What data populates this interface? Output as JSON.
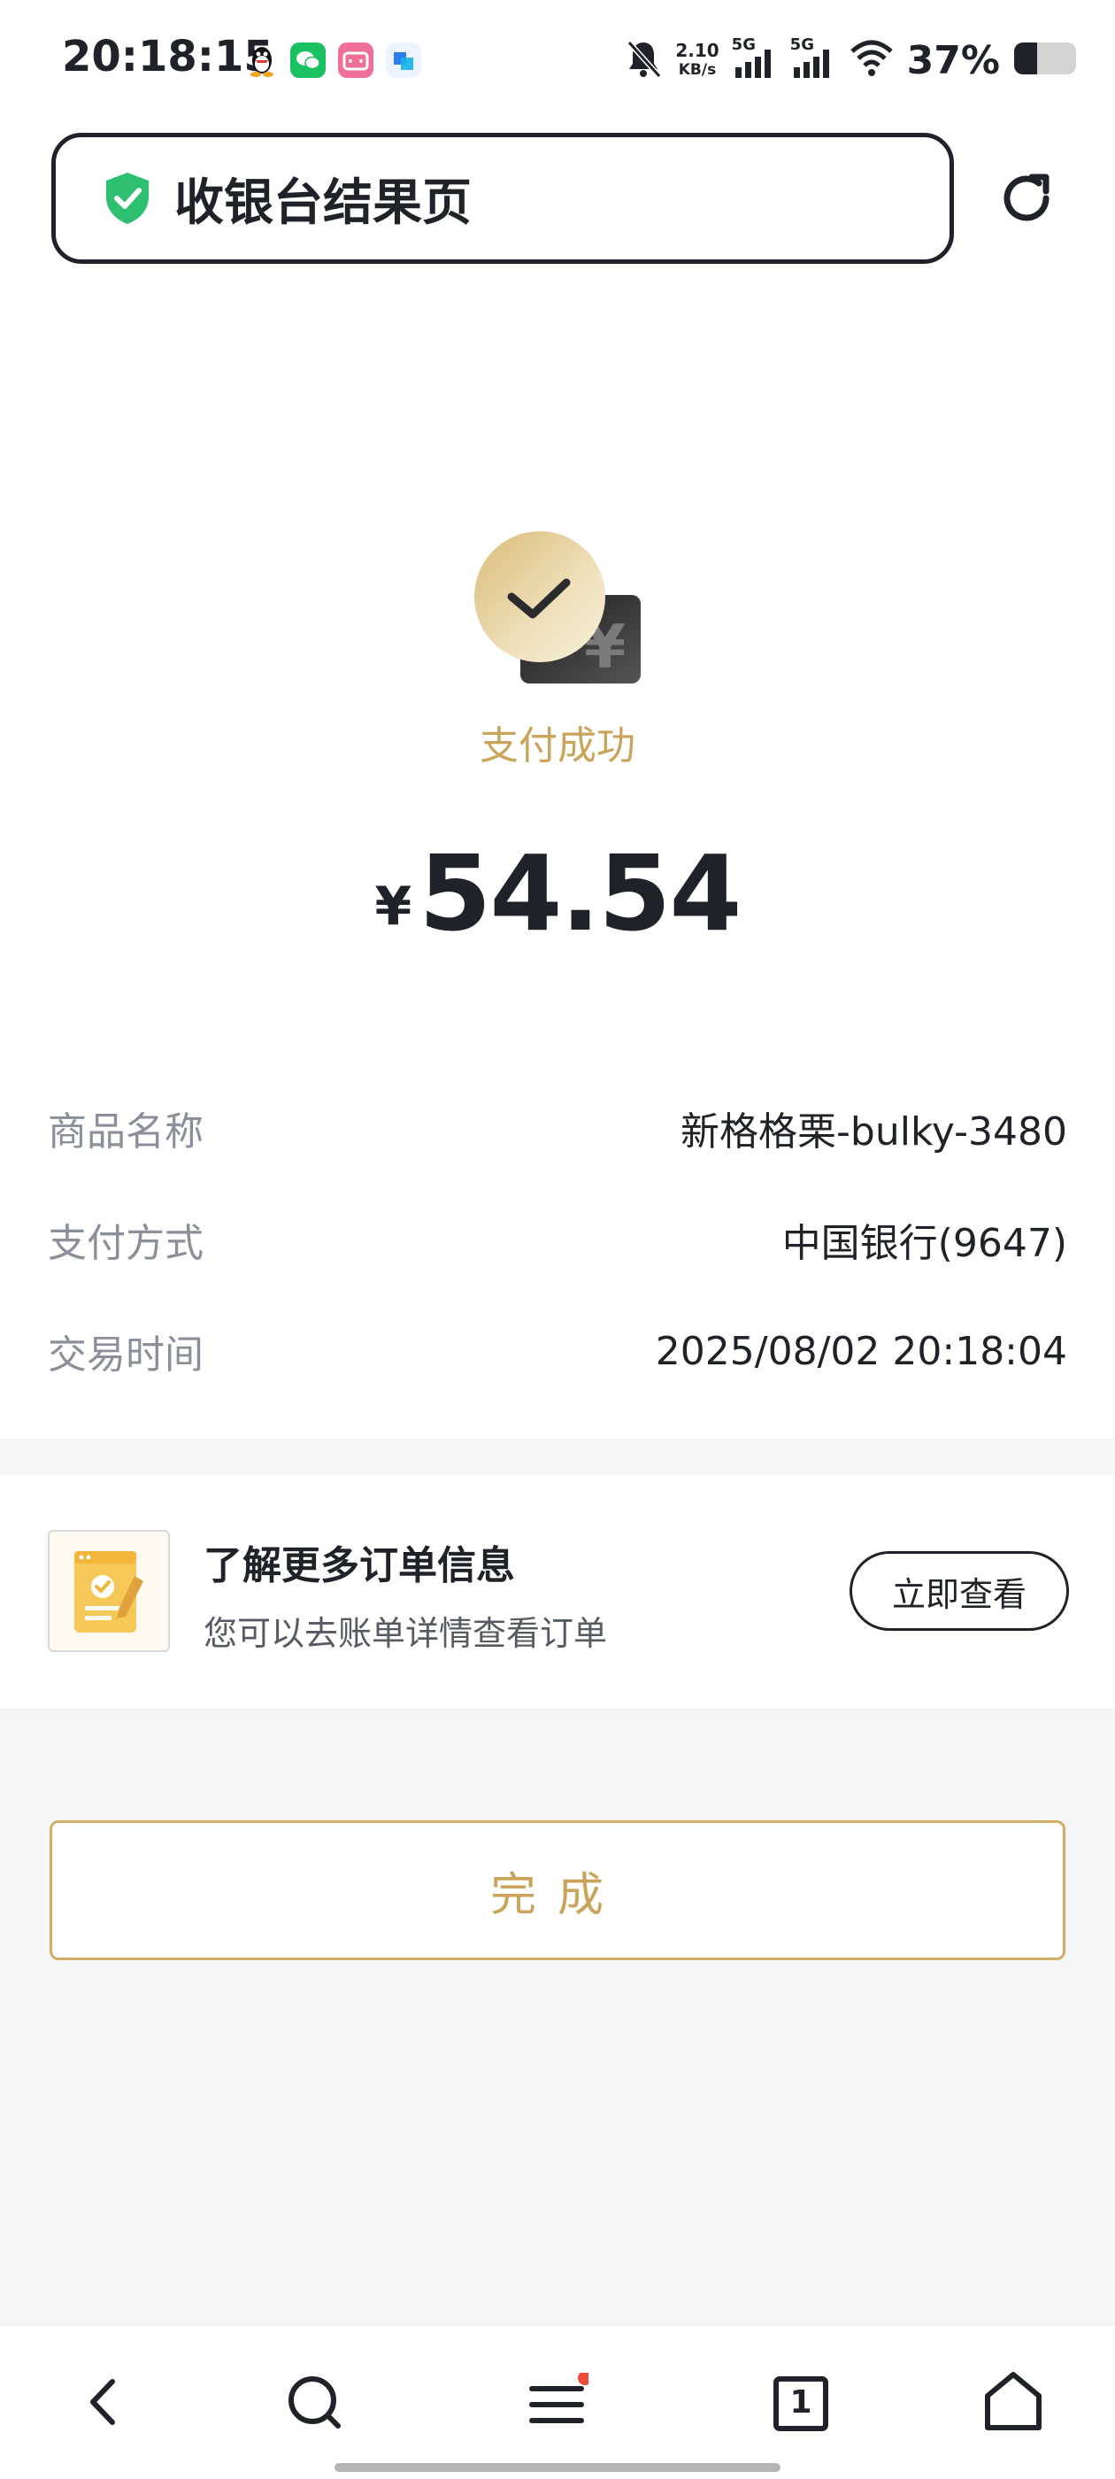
{
  "status_bar": {
    "time": "20:18:15",
    "net_speed_value": "2.10",
    "net_speed_unit": "KB/s",
    "signal_1": "5G",
    "signal_2": "5G",
    "battery": "37%"
  },
  "header": {
    "title": "收银台结果页"
  },
  "result": {
    "status": "支付成功",
    "currency": "¥",
    "amount": "54.54"
  },
  "details": [
    {
      "label": "商品名称",
      "value": "新格格栗-bulky-3480"
    },
    {
      "label": "支付方式",
      "value": "中国银行(9647)"
    },
    {
      "label": "交易时间",
      "value": "2025/08/02 20:18:04"
    }
  ],
  "order_card": {
    "title": "了解更多订单信息",
    "subtitle": "您可以去账单详情查看订单",
    "button": "立即查看"
  },
  "done_button": "完成",
  "bottom_nav": {
    "tab_count": "1"
  },
  "colors": {
    "accent_gold": "#c9a45a",
    "text_dark": "#1f2329",
    "text_gray": "#8a8f99",
    "shield_green": "#2fbf71",
    "notification_red": "#f04a3d"
  },
  "icons": [
    "qq-icon",
    "wechat-icon",
    "bilibili-icon",
    "app-icon",
    "bell-off-icon",
    "signal-icon",
    "wifi-icon",
    "battery-icon",
    "shield-check-icon",
    "refresh-icon",
    "check-coin-icon",
    "yuan-card-icon",
    "document-check-icon",
    "back-icon",
    "search-icon",
    "menu-icon",
    "tabs-icon",
    "home-icon"
  ]
}
